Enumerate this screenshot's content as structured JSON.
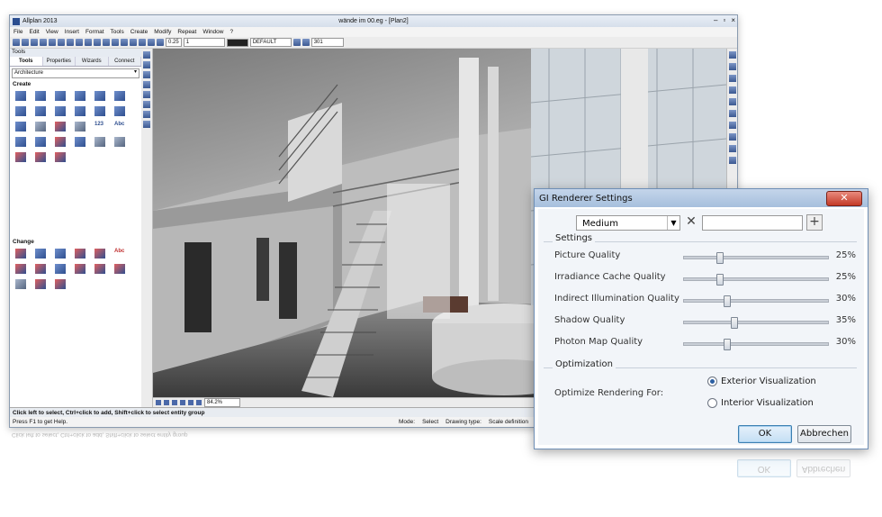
{
  "app": {
    "title": "Allplan 2013",
    "document_title": "wände im 00.eg - [Plan2]",
    "window_controls": [
      "–",
      "▫",
      "×"
    ]
  },
  "menu": [
    "File",
    "Edit",
    "View",
    "Insert",
    "Format",
    "Tools",
    "Create",
    "Modify",
    "Repeat",
    "Window",
    "?"
  ],
  "toolbar": {
    "pen_thickness": "0.25",
    "line_type": "1",
    "layer": "DEFAULT",
    "pattern": "301"
  },
  "tools_panel": {
    "header": "Tools",
    "tabs": [
      "Tools",
      "Properties",
      "Wizards",
      "Connect"
    ],
    "active_tab": "Tools",
    "module": "Architecture",
    "create_title": "Create",
    "change_title": "Change",
    "create_icon_labels": [
      "123",
      "Abc"
    ],
    "change_icon_labels": [
      "Abc"
    ]
  },
  "viewport": {
    "zoom_field": "84.2%"
  },
  "status": {
    "hint": "Click left to select, Ctrl+click to add, Shift+click to select entity group",
    "help": "Press F1 to get Help.",
    "mode": "Mode:",
    "select": "Select",
    "drawing_type_label": "Drawing type:",
    "drawing_type": "Scale definition"
  },
  "dialog": {
    "title": "GI Renderer Settings",
    "close": "✕",
    "preset": "Medium",
    "preset_add": "+",
    "preset_delete": "✕",
    "settings_group": "Settings",
    "settings": [
      {
        "label": "Picture Quality",
        "value_text": "25%",
        "value": 25
      },
      {
        "label": "Irradiance Cache Quality",
        "value_text": "25%",
        "value": 25
      },
      {
        "label": "Indirect Illumination Quality",
        "value_text": "30%",
        "value": 30
      },
      {
        "label": "Shadow Quality",
        "value_text": "35%",
        "value": 35
      },
      {
        "label": "Photon Map Quality",
        "value_text": "30%",
        "value": 30
      }
    ],
    "optimization_group": "Optimization",
    "optimize_label": "Optimize Rendering For:",
    "options": [
      "Exterior Visualization",
      "Interior Visualization"
    ],
    "selected_option": "Exterior Visualization",
    "ok": "OK",
    "cancel": "Abbrechen"
  },
  "colors": {
    "title_gradient_top": "#c4d5ea",
    "close_button": "#c33a28",
    "ok_button": "#c4dff4",
    "accent_blue": "#2b5fa3"
  }
}
